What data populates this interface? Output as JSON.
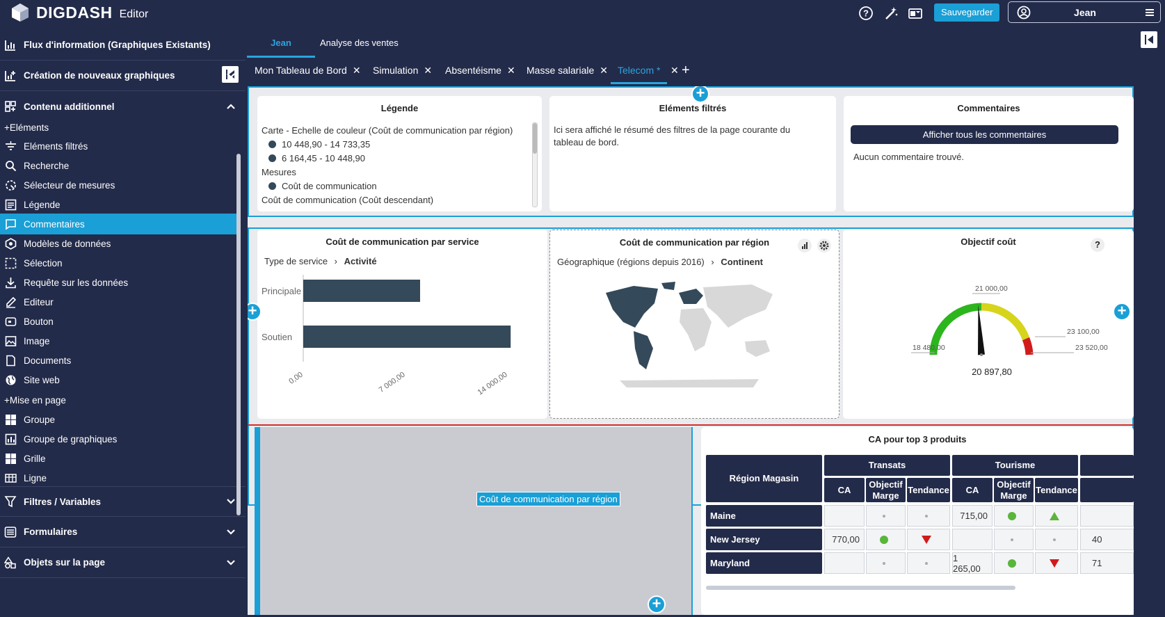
{
  "app": {
    "brand": "DIGDASH",
    "sub": "Editor"
  },
  "topbar": {
    "help_icon": "question-circle-icon",
    "magic_icon": "magic-wand-icon",
    "outlook_icon": "outlook-icon",
    "save_label": "Sauvegarder",
    "user_name": "Jean",
    "accent": "#1a9fd6"
  },
  "sidebar": {
    "sections": [
      {
        "label": "Flux d'information (Graphiques Existants)",
        "icon": "chart-bar-icon"
      },
      {
        "label": "Création de nouveaux graphiques",
        "icon": "chart-add-icon"
      },
      {
        "label": "Contenu additionnel",
        "icon": "content-add-icon"
      }
    ],
    "groups": [
      "Eléments",
      "Mise en page"
    ],
    "elements": [
      {
        "label": "Eléments filtrés",
        "icon": "filter-lines-icon"
      },
      {
        "label": "Recherche",
        "icon": "search-icon"
      },
      {
        "label": "Sélecteur de mesures",
        "icon": "measure-selector-icon"
      },
      {
        "label": "Légende",
        "icon": "legend-icon"
      },
      {
        "label": "Commentaires",
        "icon": "comment-icon"
      },
      {
        "label": "Modèles de données",
        "icon": "data-model-icon"
      },
      {
        "label": "Sélection",
        "icon": "selection-icon"
      },
      {
        "label": "Requête sur les données",
        "icon": "download-icon"
      },
      {
        "label": "Editeur",
        "icon": "edit-icon"
      },
      {
        "label": "Bouton",
        "icon": "button-icon"
      },
      {
        "label": "Image",
        "icon": "image-icon"
      },
      {
        "label": "Documents",
        "icon": "document-icon"
      },
      {
        "label": "Site web",
        "icon": "globe-icon"
      }
    ],
    "layout_items": [
      {
        "label": "Groupe",
        "icon": "group-icon"
      },
      {
        "label": "Groupe de graphiques",
        "icon": "chart-group-icon"
      },
      {
        "label": "Grille",
        "icon": "grid-icon"
      },
      {
        "label": "Ligne",
        "icon": "row-icon"
      }
    ],
    "bottom_sections": [
      {
        "label": "Filtres / Variables",
        "icon": "filter-icon"
      },
      {
        "label": "Formulaires",
        "icon": "form-icon"
      },
      {
        "label": "Objets sur la page",
        "icon": "shapes-icon"
      }
    ]
  },
  "pagetabs": [
    "Jean",
    "Analyse des ventes"
  ],
  "dashtabs": [
    "Mon Tableau de Bord",
    "Simulation",
    "Absentéisme",
    "Masse salariale",
    "Telecom *"
  ],
  "legend_card": {
    "title": "Légende",
    "lines": [
      "Carte - Echelle de couleur (Coût de communication par région)",
      "10 448,90 - 14 733,35",
      "6 164,45 - 10 448,90",
      "Mesures",
      "Coût de communication",
      "Coût de communication (Coût descendant)"
    ]
  },
  "filters_card": {
    "title": "Eléments filtrés",
    "text": "Ici sera affiché le résumé des filtres de la page courante du tableau de bord."
  },
  "comments_card": {
    "title": "Commentaires",
    "button": "Afficher tous les commentaires",
    "empty": "Aucun commentaire trouvé."
  },
  "service_chart": {
    "title": "Coût de communication par service",
    "breadcrumb_1": "Type de service",
    "breadcrumb_2": "Activité"
  },
  "region_card": {
    "title": "Coût de communication par région",
    "breadcrumb_1": "Géographique (régions depuis 2016)",
    "breadcrumb_2": "Continent"
  },
  "gauge_card": {
    "title": "Objectif coût",
    "labels": [
      "21 000,00",
      "18 480,00",
      "23 100,00",
      "23 520,00"
    ],
    "value_label": "20 897,80"
  },
  "drop_zone": {
    "label": "Coût de communication par région"
  },
  "table": {
    "title": "CA pour top 3 produits",
    "region_header": "Région Magasin",
    "groups": [
      "Transats",
      "Tourisme"
    ],
    "cols": [
      "CA",
      "Objectif Marge",
      "Tendance"
    ],
    "rows": [
      {
        "region": "Maine",
        "cells": [
          "",
          "dot-grey",
          "dot-grey",
          "715,00",
          "dot-green",
          "up-green"
        ],
        "extra": ""
      },
      {
        "region": "New Jersey",
        "cells": [
          "770,00",
          "dot-green",
          "down-red",
          "",
          "dot-grey",
          "dot-grey"
        ],
        "extra": "40"
      },
      {
        "region": "Maryland",
        "cells": [
          "",
          "dot-grey",
          "dot-grey",
          "1 265,00",
          "dot-green",
          "down-red"
        ],
        "extra": "71"
      }
    ]
  },
  "chart_data": [
    {
      "type": "bar",
      "title": "Coût de communication par service",
      "categories": [
        "Principale",
        "Soutien"
      ],
      "values": [
        8000,
        14200
      ],
      "xlim": [
        0,
        14000
      ],
      "xticks": [
        "0,00",
        "7 000,00",
        "14 000,00"
      ],
      "orientation": "horizontal",
      "color": "#34495a"
    },
    {
      "type": "gauge",
      "title": "Objectif coût",
      "min": 18480,
      "max": 23520,
      "value": 20897.8
    }
  ]
}
